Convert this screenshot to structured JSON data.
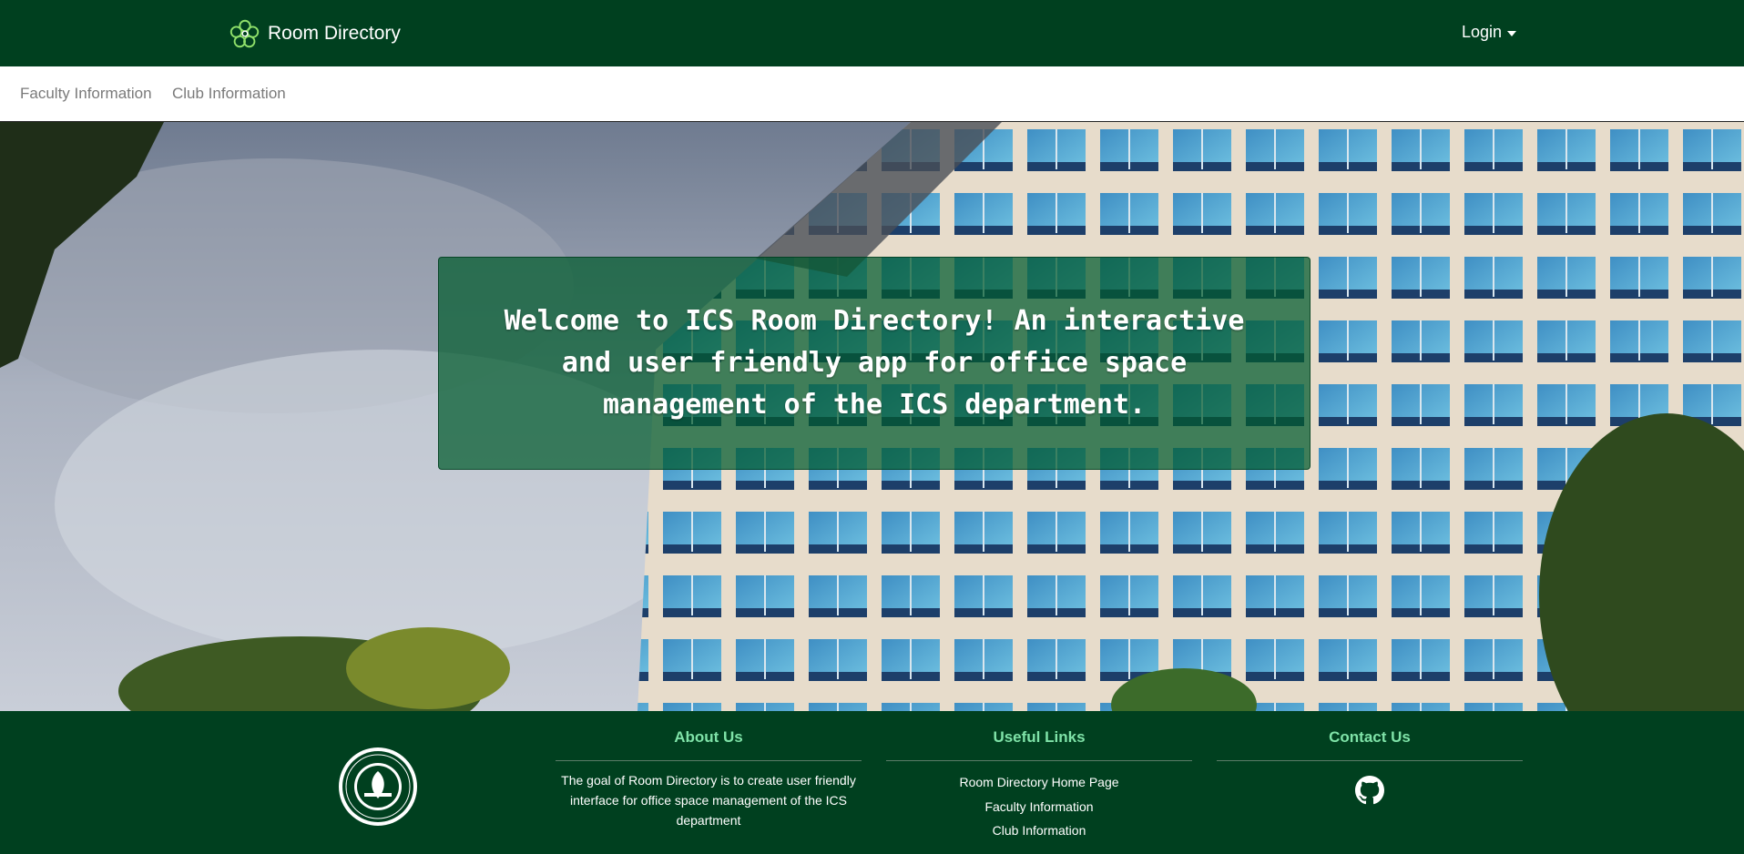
{
  "navbar": {
    "brand_label": "Room Directory",
    "brand_icon": "flower-logo-icon",
    "login_label": "Login"
  },
  "subnav": {
    "items": [
      {
        "label": "Faculty Information"
      },
      {
        "label": "Club Information"
      }
    ]
  },
  "hero": {
    "welcome_text": "Welcome to ICS Room Directory! An interactive and user friendly app for office space management of the ICS department."
  },
  "footer": {
    "seal_icon": "university-seal-icon",
    "about": {
      "title": "About Us",
      "text": "The goal of Room Directory is to create user friendly interface for office space management of the ICS department"
    },
    "useful_links": {
      "title": "Useful Links",
      "links": [
        {
          "label": "Room Directory Home Page"
        },
        {
          "label": "Faculty Information"
        },
        {
          "label": "Club Information"
        }
      ]
    },
    "contact": {
      "title": "Contact Us",
      "icon": "github-icon"
    }
  },
  "colors": {
    "primary_green": "#00401f",
    "accent_green": "#7fe3a8",
    "overlay_green": "#005a2d"
  }
}
